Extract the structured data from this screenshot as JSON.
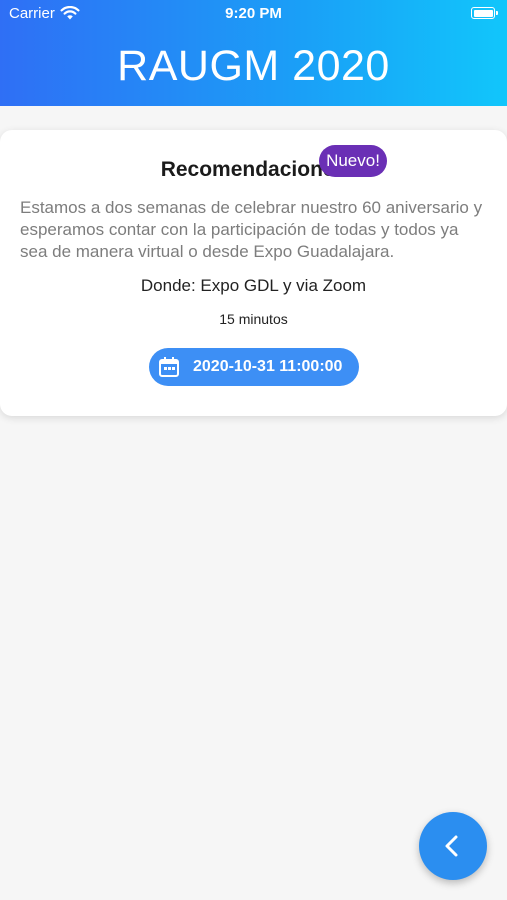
{
  "status_bar": {
    "carrier": "Carrier",
    "time": "9:20 PM"
  },
  "header": {
    "title": "RAUGM 2020"
  },
  "card": {
    "title": "Recomendaciones",
    "badge": "Nuevo!",
    "description": "Estamos a dos semanas de celebrar nuestro 60 aniversario y esperamos contar con la participación de todas y todos ya sea de manera virtual o desde Expo Guadalajara.",
    "location": "Donde: Expo GDL y  via Zoom",
    "duration": "15 minutos",
    "date": "2020-10-31 11:00:00"
  },
  "icons": {
    "wifi": "wifi-icon",
    "battery": "battery-icon",
    "calendar": "calendar-icon",
    "back": "chevron-left-icon"
  },
  "colors": {
    "header_start": "#2f6ff5",
    "header_end": "#11c6fb",
    "badge": "#6a2fb5",
    "date_button": "#3d8ff5",
    "fab": "#2b8ef0"
  }
}
